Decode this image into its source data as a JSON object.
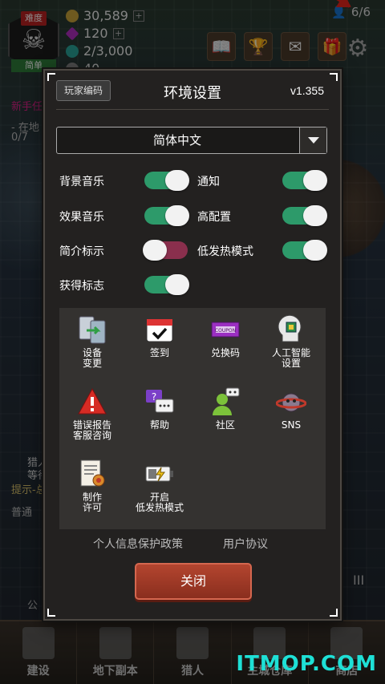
{
  "hud": {
    "difficulty_top": "难度",
    "difficulty_bottom": "简单",
    "gold": "30,589",
    "gems": "120",
    "souls": "2/3,000",
    "fourth": "40",
    "population": "6/6",
    "side_quest": "新手任",
    "side_sub1": "- 在地",
    "side_sub2": "0/7",
    "hint": "提示-总",
    "normal_tab": "普通",
    "hunter_tag1": "猎人",
    "hunter_tag2": "等待",
    "roman": "III",
    "chat": "公"
  },
  "dialog": {
    "player_code": "玩家编码",
    "title": "环境设置",
    "version": "v1.355",
    "language": "简体中文",
    "options": {
      "bg_music": "背景音乐",
      "notify": "通知",
      "sfx": "效果音乐",
      "high_config": "高配置",
      "intro_mark": "简介标示",
      "low_heat": "低发热模式",
      "get_mark": "获得标志"
    },
    "grid": {
      "device_change": "设备\n变更",
      "checkin": "签到",
      "redeem": "兑换码",
      "ai_settings": "人工智能\n设置",
      "bug_report": "错误报告\n客服咨询",
      "help": "帮助",
      "community": "社区",
      "sns": "SNS",
      "credits": "制作\n许可",
      "enable_low_heat": "开启\n低发热模式"
    },
    "privacy": "个人信息保护政策",
    "terms": "用户协议",
    "close": "关闭"
  },
  "toggles": {
    "bg_music": "on",
    "notify": "on",
    "sfx": "on",
    "high_config": "on",
    "intro_mark": "off",
    "low_heat": "on",
    "get_mark": "on"
  },
  "nav": {
    "build": "建设",
    "dungeon": "地下副本",
    "hunter": "猎人",
    "storage": "主城仓库",
    "shop": "商店"
  },
  "watermark": "ITMOP.COM",
  "colors": {
    "toggle_on": "#2d9a6a",
    "toggle_off": "#8a2f4d",
    "close_button": "#a33a28",
    "watermark": "#1ee0d6",
    "arrow": "#e8261c"
  }
}
